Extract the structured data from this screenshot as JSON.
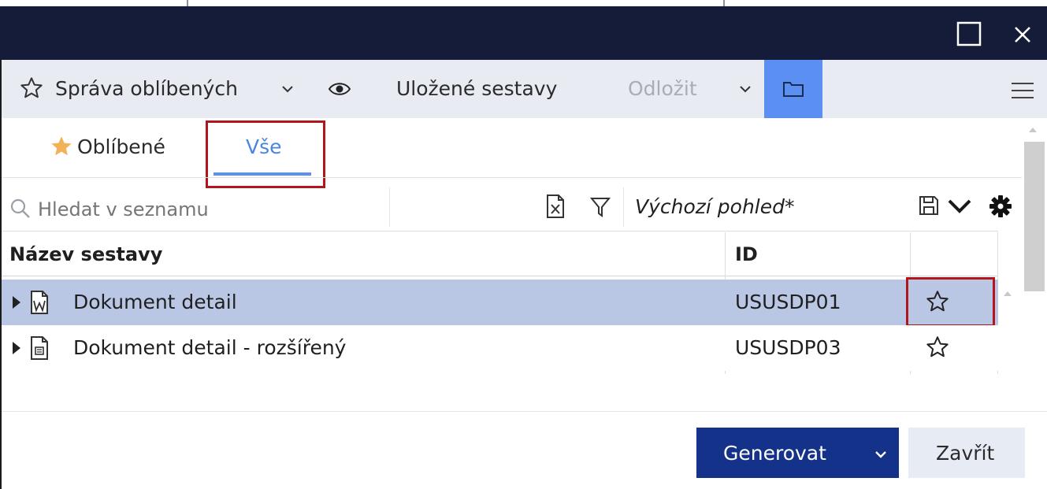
{
  "toolbar": {
    "favorites_manage_label": "Správa oblíbených",
    "saved_reports_label": "Uložené sestavy",
    "postpone_label": "Odložit",
    "accent_color": "#5b8ff2"
  },
  "tabs": [
    {
      "label": "Oblíbené",
      "icon": "star-filled-icon"
    },
    {
      "label": "Vše",
      "active": true
    }
  ],
  "search": {
    "placeholder": "Hledat v seznamu"
  },
  "view": {
    "name": "Výchozí pohled*"
  },
  "table": {
    "columns": [
      "Název sestavy",
      "ID",
      ""
    ],
    "rows": [
      {
        "name": "Dokument detail",
        "id": "USUSDP01",
        "icon": "word-document-icon",
        "selected": true
      },
      {
        "name": "Dokument detail - rozšířený",
        "id": "USUSDP03",
        "icon": "document-icon",
        "selected": false
      }
    ]
  },
  "footer": {
    "generate_label": "Generovat",
    "close_label": "Zavřít"
  },
  "colors": {
    "titlebar": "#141c3a",
    "selected_row": "#b9c6e4",
    "primary_button": "#14328a",
    "highlight": "#b3151c"
  }
}
